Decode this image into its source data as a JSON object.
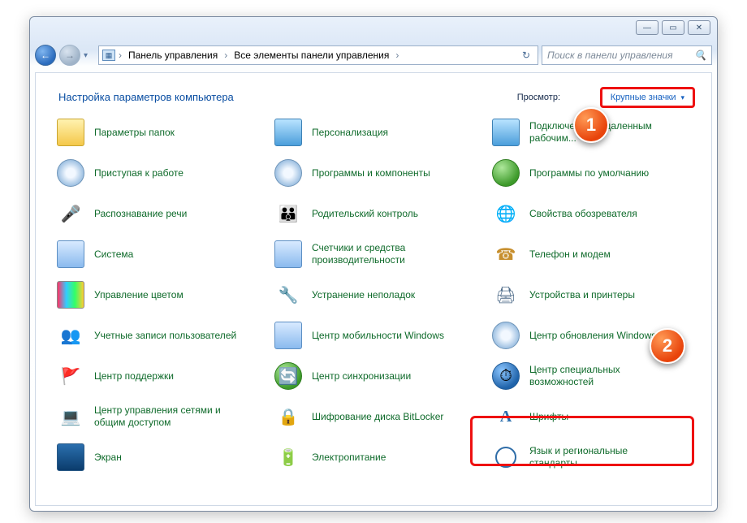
{
  "window": {
    "min": "—",
    "max": "▭",
    "close": "✕"
  },
  "nav": {
    "back_glyph": "←",
    "fwd_glyph": "→",
    "chev": "▾"
  },
  "breadcrumb": {
    "level1": "Панель управления",
    "level2": "Все элементы панели управления",
    "sep": "›"
  },
  "search": {
    "placeholder": "Поиск в панели управления",
    "icon": "🔍"
  },
  "heading": "Настройка параметров компьютера",
  "view": {
    "label_prefix": "Просмотр:",
    "mode": "Крупные значки"
  },
  "items": [
    {
      "label": "Параметры папок",
      "icon_name": "folder-options-icon",
      "icon_class": "i-folder"
    },
    {
      "label": "Персонализация",
      "icon_name": "personalization-icon",
      "icon_class": "i-mon"
    },
    {
      "label": "Подключения к удаленным рабочим...",
      "icon_name": "remote-desktop-icon",
      "icon_class": "i-mon"
    },
    {
      "label": "Приступая к работе",
      "icon_name": "getting-started-icon",
      "icon_class": "i-disc"
    },
    {
      "label": "Программы и компоненты",
      "icon_name": "programs-features-icon",
      "icon_class": "i-disc"
    },
    {
      "label": "Программы по умолчанию",
      "icon_name": "default-programs-icon",
      "icon_class": "i-green"
    },
    {
      "label": "Распознавание речи",
      "icon_name": "speech-icon",
      "icon_class": "i-mic",
      "glyph": "🎤"
    },
    {
      "label": "Родительский контроль",
      "icon_name": "parental-icon",
      "icon_class": "i-users",
      "glyph": "👪"
    },
    {
      "label": "Свойства обозревателя",
      "icon_name": "internet-options-icon",
      "icon_class": "i-globe",
      "glyph": "🌐"
    },
    {
      "label": "Система",
      "icon_name": "system-icon",
      "icon_class": "i-sys"
    },
    {
      "label": "Счетчики и средства производительности",
      "icon_name": "perf-icon",
      "icon_class": "i-sys"
    },
    {
      "label": "Телефон и модем",
      "icon_name": "phone-modem-icon",
      "icon_class": "i-phone",
      "glyph": "☎"
    },
    {
      "label": "Управление цветом",
      "icon_name": "color-mgmt-icon",
      "icon_class": "i-color"
    },
    {
      "label": "Устранение неполадок",
      "icon_name": "troubleshoot-icon",
      "icon_class": "i-tool",
      "glyph": "🔧"
    },
    {
      "label": "Устройства и принтеры",
      "icon_name": "devices-printers-icon",
      "icon_class": "i-printer",
      "glyph": "🖨"
    },
    {
      "label": "Учетные записи пользователей",
      "icon_name": "user-accounts-icon",
      "icon_class": "i-users",
      "glyph": "👥"
    },
    {
      "label": "Центр мобильности Windows",
      "icon_name": "mobility-center-icon",
      "icon_class": "i-sys"
    },
    {
      "label": "Центр обновления Windows",
      "icon_name": "windows-update-icon",
      "icon_class": "i-disc"
    },
    {
      "label": "Центр поддержки",
      "icon_name": "action-center-icon",
      "icon_class": "i-flag",
      "glyph": "🚩"
    },
    {
      "label": "Центр синхронизации",
      "icon_name": "sync-center-icon",
      "icon_class": "i-green",
      "glyph": "🔄"
    },
    {
      "label": "Центр специальных возможностей",
      "icon_name": "ease-of-access-icon",
      "icon_class": "i-blue",
      "glyph": "⏱"
    },
    {
      "label": "Центр управления сетями и общим доступом",
      "icon_name": "network-sharing-icon",
      "icon_class": "i-net",
      "glyph": "💻"
    },
    {
      "label": "Шифрование диска BitLocker",
      "icon_name": "bitlocker-icon",
      "icon_class": "i-lock",
      "glyph": "🔒"
    },
    {
      "label": "Шрифты",
      "icon_name": "fonts-icon",
      "icon_class": "i-font",
      "glyph": "A"
    },
    {
      "label": "Экран",
      "icon_name": "display-icon",
      "icon_class": "i-screen"
    },
    {
      "label": "Электропитание",
      "icon_name": "power-icon",
      "icon_class": "i-power",
      "glyph": "🔋"
    },
    {
      "label": "Язык и региональные стандарты",
      "icon_name": "region-lang-icon",
      "icon_class": "i-clock"
    }
  ],
  "callouts": {
    "one": "1",
    "two": "2"
  }
}
